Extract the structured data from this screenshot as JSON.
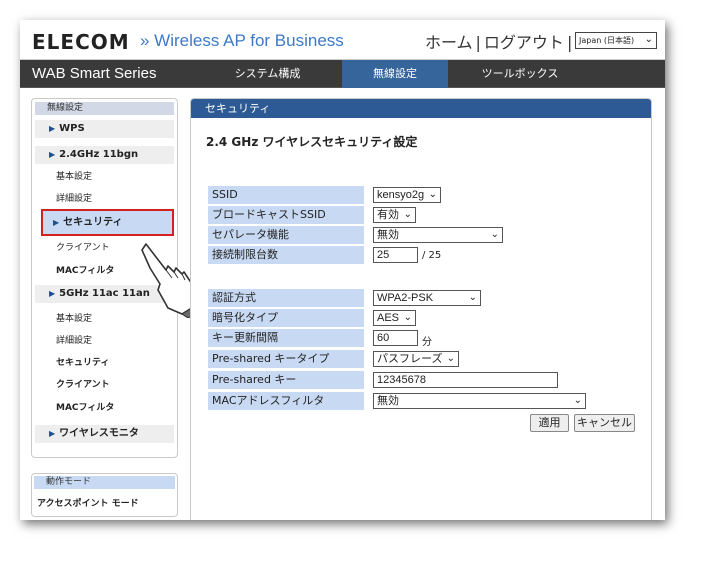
{
  "header": {
    "logo": "ELECOM",
    "product": "» Wireless AP for Business",
    "home": "ホーム",
    "separator": "|",
    "logout": "ログアウト",
    "language": "Japan (日本語)"
  },
  "nav": {
    "series": "WAB Smart Series",
    "tabs": [
      {
        "label": "システム構成",
        "active": false
      },
      {
        "label": "無線設定",
        "active": true
      },
      {
        "label": "ツールボックス",
        "active": false
      }
    ]
  },
  "sidebar": {
    "section": "無線設定",
    "items": [
      {
        "label": "WPS"
      },
      {
        "label": "2.4GHz 11bgn"
      },
      {
        "label": "基本設定"
      },
      {
        "label": "詳細設定"
      },
      {
        "label": "セキュリティ"
      },
      {
        "label": "クライアント"
      },
      {
        "label": "MACフィルタ"
      },
      {
        "label": "5GHz 11ac 11an"
      },
      {
        "label": "基本設定"
      },
      {
        "label": "詳細設定"
      },
      {
        "label": "セキュリティ"
      },
      {
        "label": "クライアント"
      },
      {
        "label": "MACフィルタ"
      },
      {
        "label": "ワイヤレスモニタ"
      }
    ]
  },
  "mode": {
    "title": "動作モード",
    "value": "アクセスポイント モード"
  },
  "panel": {
    "header": "セキュリティ",
    "title": "2.4 GHz ワイヤレスセキュリティ設定",
    "fields": {
      "ssid": {
        "label": "SSID",
        "value": "kensyo2g"
      },
      "broadcast": {
        "label": "ブロードキャストSSID",
        "value": "有効"
      },
      "separator": {
        "label": "セパレータ機能",
        "value": "無効"
      },
      "max_clients": {
        "label": "接続制限台数",
        "value": "25",
        "unit": "/ 25"
      },
      "auth": {
        "label": "認証方式",
        "value": "WPA2-PSK"
      },
      "encryption": {
        "label": "暗号化タイプ",
        "value": "AES"
      },
      "key_interval": {
        "label": "キー更新間隔",
        "value": "60",
        "unit": "分"
      },
      "psk_type": {
        "label": "Pre-shared キータイプ",
        "value": "パスフレーズ"
      },
      "psk": {
        "label": "Pre-shared キー",
        "value": "12345678"
      },
      "mac_filter": {
        "label": "MACアドレスフィルタ",
        "value": "無効"
      }
    },
    "apply": "適用",
    "cancel": "キャンセル"
  },
  "colors": {
    "accent": "#2d5a95",
    "active_tab": "#35659b",
    "label_bg": "#c8daf3",
    "highlight_border": "#d42020",
    "product_text": "#3c79c7"
  },
  "icons": {
    "chevron": "chevron-down-icon",
    "arrow": "triangle-right-icon",
    "pointer": "pointing-hand-icon"
  }
}
